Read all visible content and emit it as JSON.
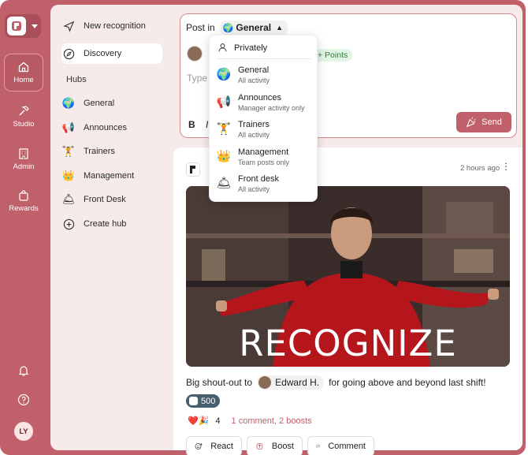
{
  "rail": {
    "items": [
      {
        "label": "Home",
        "icon": "home-icon"
      },
      {
        "label": "Studio",
        "icon": "hammer-icon"
      },
      {
        "label": "Admin",
        "icon": "building-icon"
      },
      {
        "label": "Rewards",
        "icon": "bag-icon"
      }
    ],
    "avatar_initials": "LY"
  },
  "sidebar": {
    "new_recognition": "New recognition",
    "discovery": "Discovery",
    "hubs_heading": "Hubs",
    "hubs": [
      {
        "label": "General",
        "emoji": "🌍"
      },
      {
        "label": "Announces",
        "emoji": "📢"
      },
      {
        "label": "Trainers",
        "emoji": "🏋"
      },
      {
        "label": "Management",
        "emoji": "👑"
      },
      {
        "label": "Front Desk",
        "emoji": "🛎"
      }
    ],
    "create_hub": "Create hub"
  },
  "composer": {
    "post_in_label": "Post in",
    "selected_hub": "General",
    "selected_hub_emoji": "🌍",
    "points_chip": "+ Points",
    "placeholder": "Type",
    "bold": "B",
    "italic": "I",
    "send_label": "Send"
  },
  "dropdown": {
    "private_label": "Privately",
    "items": [
      {
        "name": "General",
        "sub": "All activity",
        "emoji": "🌍"
      },
      {
        "name": "Announces",
        "sub": "Manager activity only",
        "emoji": "📢"
      },
      {
        "name": "Trainers",
        "sub": "All activity",
        "emoji": "🏋"
      },
      {
        "name": "Management",
        "sub": "Team posts only",
        "emoji": "👑"
      },
      {
        "name": "Front desk",
        "sub": "All activity",
        "emoji": "🛎"
      }
    ]
  },
  "post": {
    "time": "2 hours ago",
    "gif_text": "RECOGNIZE",
    "caption_before": "Big shout-out to",
    "mention": "Edward H.",
    "caption_after": "for going above and beyond last shift!",
    "points": "500",
    "reaction_emojis": "❤️🎉",
    "reaction_count": "4",
    "comments_boosts": "1 comment, 2 boosts",
    "actions": {
      "react": "React",
      "boost": "Boost",
      "comment": "Comment"
    }
  },
  "colors": {
    "brand": "#c0606a",
    "panel": "#f6eaea",
    "points_badge": "#46606e"
  }
}
